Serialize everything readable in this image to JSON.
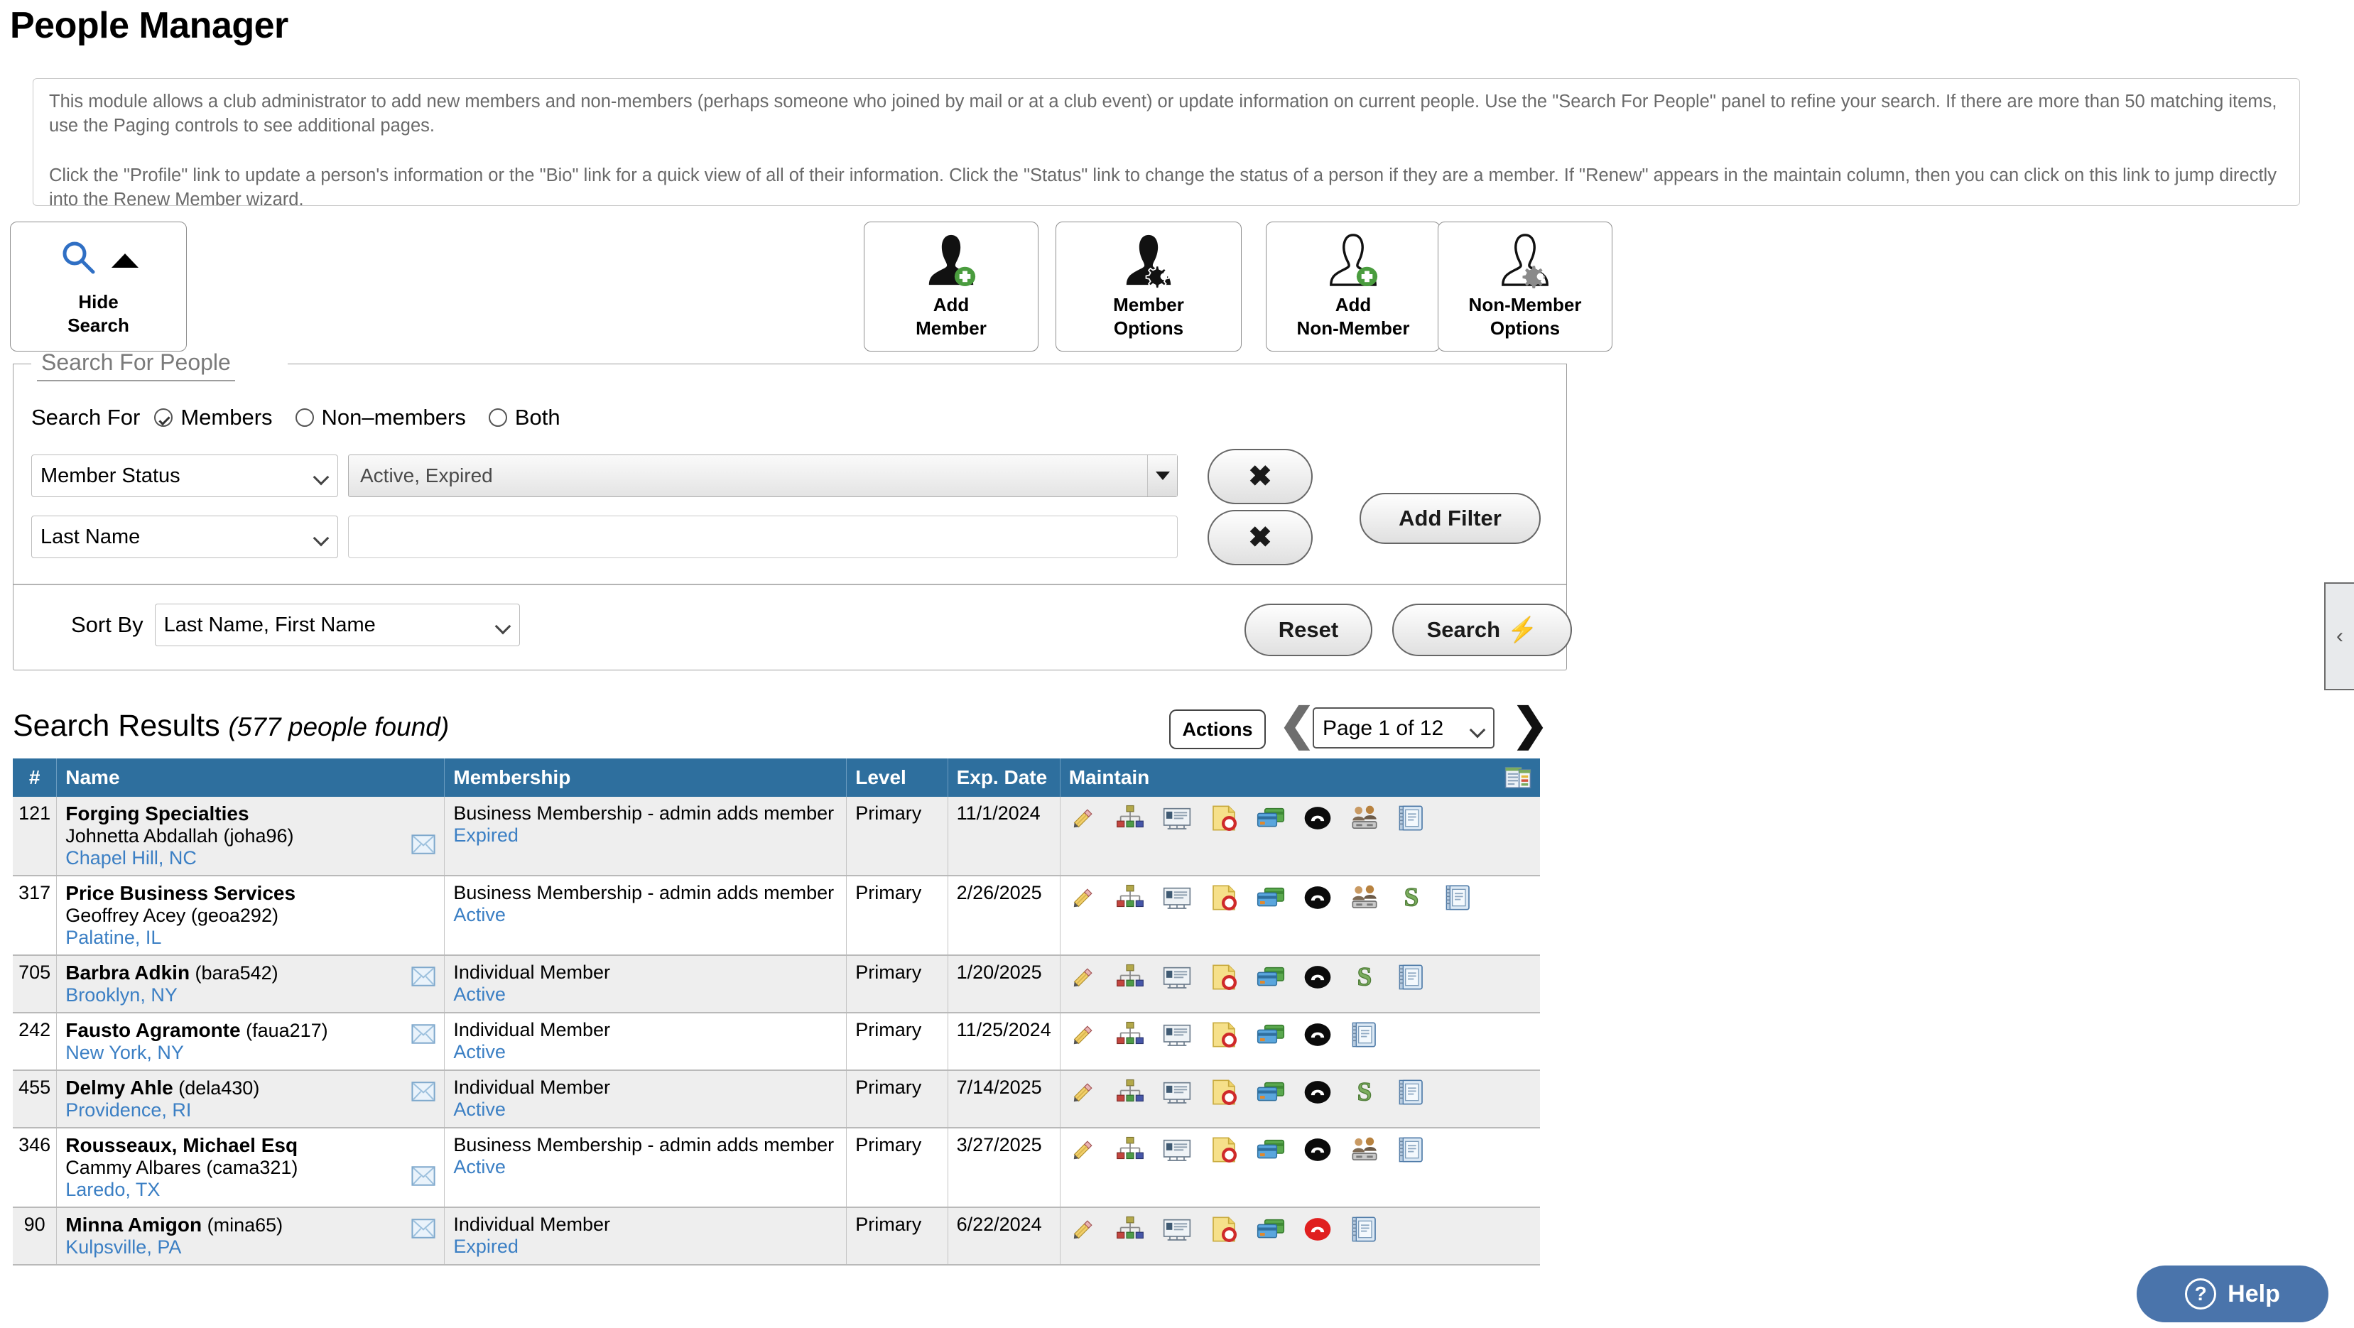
{
  "page_title": "People Manager",
  "description": {
    "paragraph1": "This module allows a club administrator to add new members and non-members (perhaps someone who joined by mail or at a club event) or update information on current people. Use the \"Search For People\" panel to refine your search. If there are more than 50 matching items, use the Paging controls to see additional pages.",
    "paragraph2": "Click the \"Profile\" link to update a person's information or the \"Bio\" link for a quick view of all of their information. Click the \"Status\" link to change the status of a person if they are a member. If \"Renew\" appears in the maintain column, then you can click on this link to jump directly into the Renew Member wizard."
  },
  "toolbar": {
    "hide_search": "Hide\nSearch",
    "hide_search_line1": "Hide",
    "hide_search_line2": "Search",
    "add_member_line1": "Add",
    "add_member_line2": "Member",
    "member_options_line1": "Member",
    "member_options_line2": "Options",
    "add_non_member_line1": "Add",
    "add_non_member_line2": "Non-Member",
    "non_member_options_line1": "Non-Member",
    "non_member_options_line2": "Options"
  },
  "search_panel": {
    "legend": "Search For People",
    "search_for_label": "Search For",
    "options": [
      {
        "label": "Members",
        "selected": true
      },
      {
        "label": "Non–members",
        "selected": false
      },
      {
        "label": "Both",
        "selected": false
      }
    ],
    "filters": [
      {
        "field": "Member Status",
        "value": "Active, Expired",
        "type": "multiselect",
        "clear_label": "✖"
      },
      {
        "field": "Last Name",
        "value": "",
        "type": "text",
        "clear_label": "✖"
      }
    ],
    "add_filter_label": "Add Filter",
    "sort_by_label": "Sort By",
    "sort_by_value": "Last Name, First Name",
    "reset_label": "Reset",
    "search_label": "Search",
    "search_icon": "lightning-bolt"
  },
  "results": {
    "title": "Search Results",
    "count_text": "(577 people found)",
    "actions_label": "Actions",
    "page_label": "Page 1 of 12",
    "prev_icon": "chevron-left",
    "next_icon": "chevron-right",
    "columns": [
      "#",
      "Name",
      "Membership",
      "Level",
      "Exp. Date",
      "Maintain"
    ],
    "rows": [
      {
        "num": "121",
        "name_line1": "Forging Specialties",
        "name_line2": "Johnetta Abdallah (joha96)",
        "name_line3": "Chapel Hill, NC",
        "has_mail": true,
        "membership": "Business Membership - admin adds member",
        "status": "Expired",
        "level": "Primary",
        "exp_date": "11/1/2024",
        "maintain_icons": [
          "pencil",
          "sitemap",
          "namecard",
          "note",
          "cards",
          "phone-black",
          "people-link",
          "address-book"
        ]
      },
      {
        "num": "317",
        "name_line1": "Price Business Services",
        "name_line2": "Geoffrey Acey (geoa292)",
        "name_line3": "Palatine, IL",
        "has_mail": false,
        "membership": "Business Membership - admin adds member",
        "status": "Active",
        "level": "Primary",
        "exp_date": "2/26/2025",
        "maintain_icons": [
          "pencil",
          "sitemap",
          "namecard",
          "note",
          "cards",
          "phone-black",
          "people-link",
          "dollar",
          "address-book"
        ]
      },
      {
        "num": "705",
        "name_line1": "Barbra Adkin",
        "name_userid": "(bara542)",
        "name_line3": "Brooklyn, NY",
        "has_mail": true,
        "membership": "Individual Member",
        "status": "Active",
        "level": "Primary",
        "exp_date": "1/20/2025",
        "maintain_icons": [
          "pencil",
          "sitemap",
          "namecard",
          "note",
          "cards",
          "phone-black",
          "dollar",
          "address-book"
        ]
      },
      {
        "num": "242",
        "name_line1": "Fausto Agramonte",
        "name_userid": "(faua217)",
        "name_line3": "New York, NY",
        "has_mail": true,
        "membership": "Individual Member",
        "status": "Active",
        "level": "Primary",
        "exp_date": "11/25/2024",
        "maintain_icons": [
          "pencil",
          "sitemap",
          "namecard",
          "note",
          "cards",
          "phone-black",
          "address-book"
        ]
      },
      {
        "num": "455",
        "name_line1": "Delmy Ahle",
        "name_userid": "(dela430)",
        "name_line3": "Providence, RI",
        "has_mail": true,
        "membership": "Individual Member",
        "status": "Active",
        "level": "Primary",
        "exp_date": "7/14/2025",
        "maintain_icons": [
          "pencil",
          "sitemap",
          "namecard",
          "note",
          "cards",
          "phone-black",
          "dollar",
          "address-book"
        ]
      },
      {
        "num": "346",
        "name_line1": "Rousseaux, Michael Esq",
        "name_line2": "Cammy Albares (cama321)",
        "name_line3": "Laredo, TX",
        "has_mail": true,
        "membership": "Business Membership - admin adds member",
        "status": "Active",
        "level": "Primary",
        "exp_date": "3/27/2025",
        "maintain_icons": [
          "pencil",
          "sitemap",
          "namecard",
          "note",
          "cards",
          "phone-black",
          "people-link",
          "address-book"
        ]
      },
      {
        "num": "90",
        "name_line1": "Minna Amigon",
        "name_userid": "(mina65)",
        "name_line3": "Kulpsville, PA",
        "has_mail": true,
        "membership": "Individual Member",
        "status": "Expired",
        "level": "Primary",
        "exp_date": "6/22/2024",
        "maintain_icons": [
          "pencil",
          "sitemap",
          "namecard",
          "note",
          "cards",
          "phone-red",
          "address-book"
        ]
      }
    ]
  },
  "edge_tab": {
    "icon": "chevron-left",
    "label": "‹"
  },
  "help": {
    "label": "Help",
    "icon": "question-circle"
  },
  "colors": {
    "header_blue": "#2e6f9e",
    "link_blue": "#3b7fc4",
    "help_blue": "#4a74ab",
    "accent_green": "#4a9c3e",
    "magnifier_blue": "#2f6fc4"
  }
}
